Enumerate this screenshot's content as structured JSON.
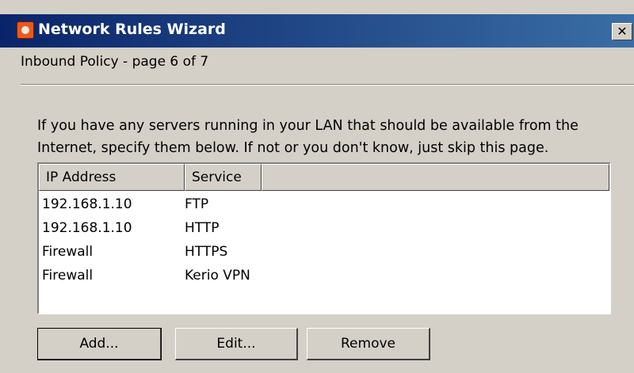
{
  "window": {
    "title": "Network Rules Wizard",
    "close_symbol": "✕",
    "icon": "kerio-wizard-icon"
  },
  "page": {
    "subtitle": "Inbound Policy - page 6 of 7",
    "description": "If you have any servers running in your LAN that should be available from the Internet, specify them below. If not or you don't know, just skip this page."
  },
  "table": {
    "headers": [
      "IP Address",
      "Service"
    ],
    "rows": [
      {
        "ip": "192.168.1.10",
        "service": "FTP"
      },
      {
        "ip": "192.168.1.10",
        "service": "HTTP"
      },
      {
        "ip": "Firewall",
        "service": "HTTPS"
      },
      {
        "ip": "Firewall",
        "service": "Kerio VPN"
      }
    ]
  },
  "buttons": {
    "add": "Add...",
    "edit": "Edit...",
    "remove": "Remove"
  },
  "colors": {
    "titlebar_start": "#0a246a",
    "titlebar_end": "#3a6ea5",
    "face": "#d4d0c8"
  }
}
